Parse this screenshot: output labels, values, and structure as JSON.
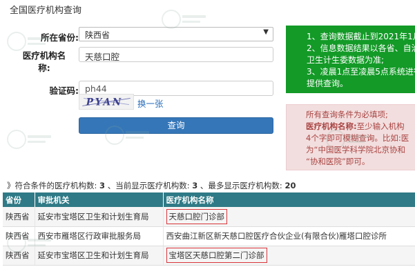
{
  "page": {
    "title": "全国医疗机构查询"
  },
  "form": {
    "province_label": "所在省份:",
    "province_value": "陕西省",
    "name_label": "医疗机构名称:",
    "name_value": "天慈口腔",
    "captcha_label": "验证码:",
    "captcha_value": "ph44",
    "captcha_image_text": "PYAN",
    "captcha_refresh": "换一张",
    "query_button": "查询"
  },
  "notice_green": {
    "lines": [
      "1、查询数据截止到2021年1月",
      "2、信息数据结果以各省、自治",
      "卫生计生委数据为准;",
      "3、凌晨1点至凌晨5点系统进行",
      "提供查询。"
    ]
  },
  "notice_pink": {
    "line1": "所有查询条件为必填项;",
    "line2_bold": "医疗机构名称:",
    "line2_rest": "至少输入机构",
    "line3": "4个字即可模糊查询。比如:医",
    "line4": "为“中国医学科学院北京协和",
    "line5": "“协和医院”即可。"
  },
  "summary": {
    "prefix": "》符合条件的医疗机构数:",
    "match_count": "3",
    "current_label": "、当前显示医疗机构数:",
    "current_count": "3",
    "max_label": "、最多显示医疗机构数:",
    "max_count": "20"
  },
  "table": {
    "headers": [
      "省份",
      "审批机关",
      "医疗机构名称"
    ],
    "rows": [
      [
        "陕西省",
        "延安市宝塔区卫生和计划生育局",
        "天慈口腔门诊部"
      ],
      [
        "陕西省",
        "西安市雁塔区行政审批服务局",
        "西安曲江新区新天慈口腔医疗合伙企业(有限合伙)雁塔口腔诊所"
      ],
      [
        "陕西省",
        "延安市宝塔区卫生和计划生育局",
        "宝塔区天慈口腔第二门诊部"
      ]
    ]
  }
}
